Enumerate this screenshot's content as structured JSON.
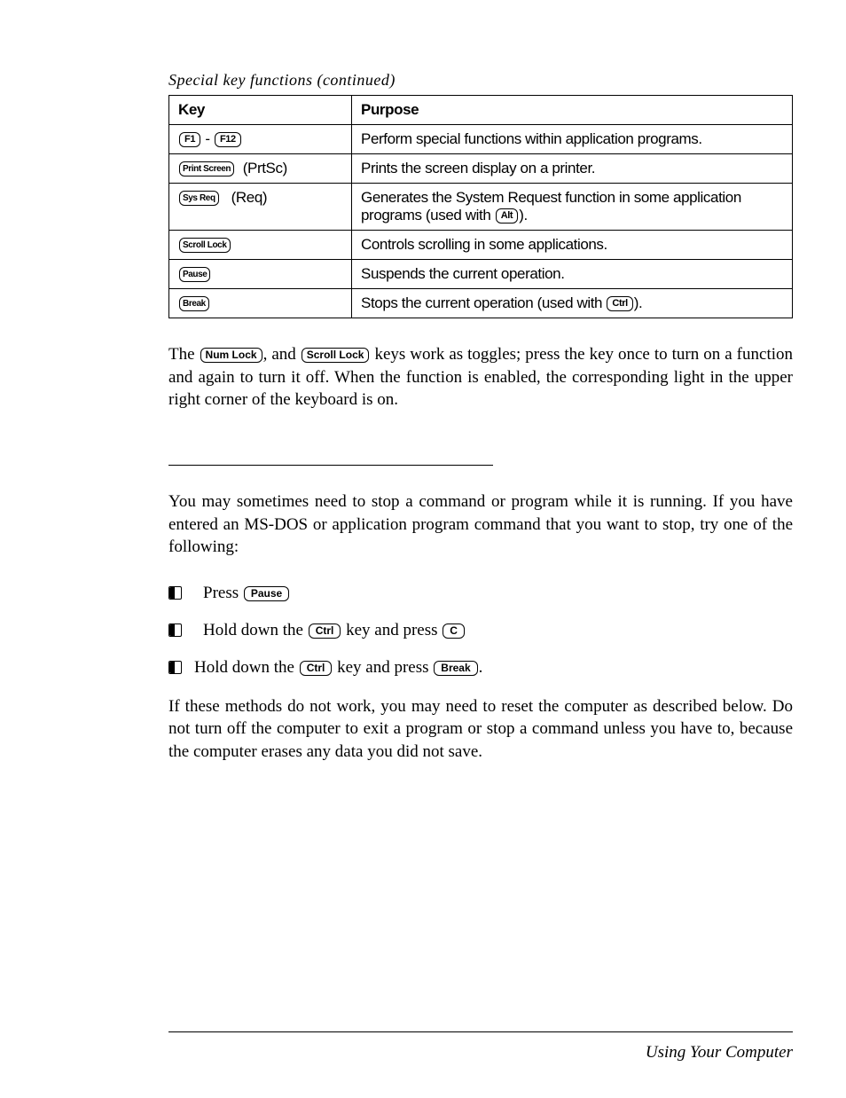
{
  "caption": "Special key functions (continued)",
  "headers": {
    "key": "Key",
    "purpose": "Purpose"
  },
  "rows": [
    {
      "key_html": "<span class='keycap'>F1</span> - <span class='keycap'>F12</span>",
      "purpose_html": "Perform special functions within application programs."
    },
    {
      "key_html": "<span class='keycap small'>Print Screen</span>&nbsp;&nbsp;(PrtSc)",
      "purpose_html": "Prints the screen display on a printer."
    },
    {
      "key_html": "<span class='keycap small'>Sys Req</span>&nbsp;&nbsp;&nbsp;(Req)",
      "purpose_html": "Generates the System Request function in some application programs (used with <span class='keycap'>Alt</span>)."
    },
    {
      "key_html": "<span class='keycap small'>Scroll Lock</span>",
      "purpose_html": "Controls scrolling in some applications."
    },
    {
      "key_html": "<span class='keycap small'>Pause</span>",
      "purpose_html": "Suspends the current operation."
    },
    {
      "key_html": "<span class='keycap small'>Break</span>",
      "purpose_html": "Stops the current operation (used with <span class='keycap'>Ctrl</span>)."
    }
  ],
  "para1_html": "The <span class='keycap'>Num Lock</span>, and <span class='keycap'>Scroll Lock</span> keys work as toggles; press the key once to turn on a function and again to turn it off. When the function is enabled, the corresponding light in the upper right corner of the keyboard is on.",
  "para2": "You may sometimes need to stop a command or program while it is running. If you have entered an MS-DOS or application program command that you want to stop, try one of the following:",
  "bullets": [
    {
      "html": "Press <span class='keycap med'>Pause</span>",
      "indent": true
    },
    {
      "html": "Hold down the <span class='keycap med'>Ctrl</span> key and press <span class='keycap med'>C</span>",
      "indent": true
    },
    {
      "html": "Hold down the <span class='keycap med'>Ctrl</span> key and press <span class='keycap med'>Break</span>.",
      "indent": false
    }
  ],
  "para3": "If these methods do not work, you may need to reset the computer as described below. Do not turn off the computer to exit a program or stop a command unless you have to, because the computer erases any data you did not save.",
  "footer": "Using Your Computer"
}
